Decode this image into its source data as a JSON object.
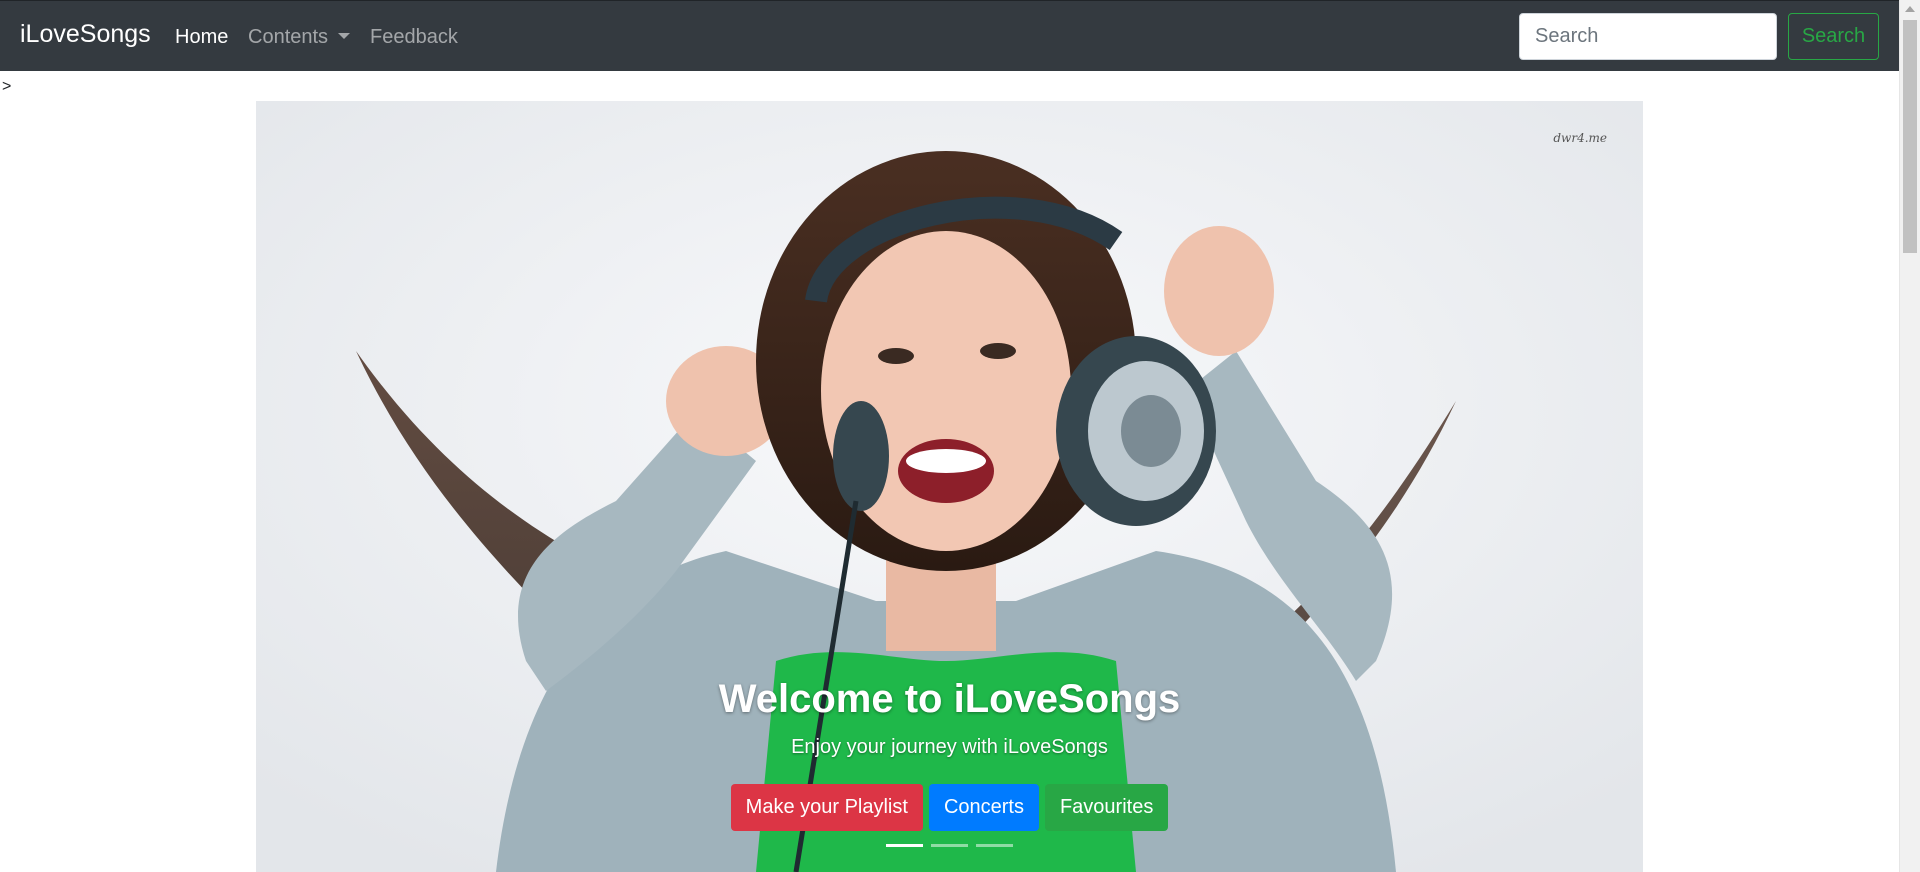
{
  "navbar": {
    "brand": "iLoveSongs",
    "links": [
      {
        "label": "Home",
        "active": true
      },
      {
        "label": "Contents",
        "dropdown": true
      },
      {
        "label": "Feedback"
      }
    ],
    "search": {
      "placeholder": "Search",
      "value": "",
      "button_label": "Search"
    }
  },
  "page": {
    "stray_text": ">"
  },
  "carousel": {
    "watermark": "dwr4.me",
    "title": "Welcome to iLoveSongs",
    "subtitle": "Enjoy your journey with iLoveSongs",
    "buttons": [
      {
        "label": "Make your Playlist",
        "color": "#dc3545"
      },
      {
        "label": "Concerts",
        "color": "#007bff"
      },
      {
        "label": "Favourites",
        "color": "#28a745"
      }
    ],
    "indicators": {
      "count": 3,
      "active_index": 0
    }
  },
  "colors": {
    "navbar_bg": "#343a40",
    "search_button_outline": "#28a745"
  }
}
